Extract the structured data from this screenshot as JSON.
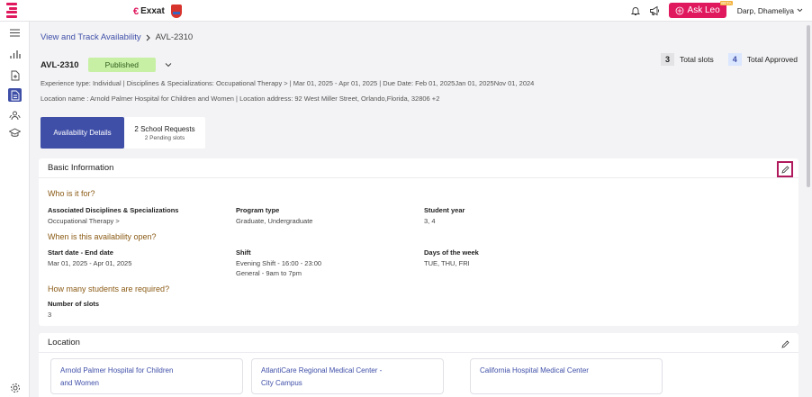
{
  "topbar": {
    "brand_text": "Exxat",
    "ask_leo_label": "Ask Leo",
    "beta_label": "BETA",
    "user_name": "Darp, Dhameliya"
  },
  "breadcrumb": {
    "parent": "View and Track Availability",
    "current": "AVL-2310"
  },
  "header": {
    "id": "AVL-2310",
    "status": "Published",
    "total_slots_count": "3",
    "total_slots_label": "Total slots",
    "total_approved_count": "4",
    "total_approved_label": "Total Approved"
  },
  "meta": {
    "line1": "Experience type:  Individual  |  Disciplines & Specializations:  Occupational Therapy  >   |  Mar 01, 2025  -  Apr 01, 2025  |  Due Date: Feb 01, 2025Jan 01, 2025Nov 01, 2024",
    "line2": "Location name : Arnold Palmer Hospital for Children and Women  |  Location address: 92 West Miller Street, Orlando,Florida, 32806    +2"
  },
  "tabs": {
    "availability": "Availability Details",
    "requests": "2 School Requests",
    "requests_sub": "2 Pending slots"
  },
  "basic": {
    "title": "Basic Information",
    "who_title": "Who is it for?",
    "disciplines_label": "Associated Disciplines & Specializations",
    "disciplines_value": "Occupational Therapy  >",
    "program_label": "Program type",
    "program_value": "Graduate,   Undergraduate",
    "year_label": "Student year",
    "year_value": "3, 4",
    "when_title": "When is this availability open?",
    "dates_label": "Start date - End date",
    "dates_value": "Mar 01, 2025  -  Apr 01, 2025",
    "shift_label": "Shift",
    "shift_value1": "Evening Shift - 16:00 - 23:00",
    "shift_value2": "General - 9am to 7pm",
    "days_label": "Days of the week",
    "days_value": "TUE, THU, FRI",
    "how_title": "How many students are required?",
    "slots_label": "Number of slots",
    "slots_value": "3"
  },
  "location": {
    "title": "Location",
    "cards": [
      {
        "line1": "Arnold Palmer Hospital for Children",
        "line2": "and Women"
      },
      {
        "line1": "AtlantiCare Regional Medical Center -",
        "line2": "City Campus"
      },
      {
        "line1": "California Hospital Medical Center",
        "line2": ""
      }
    ]
  }
}
